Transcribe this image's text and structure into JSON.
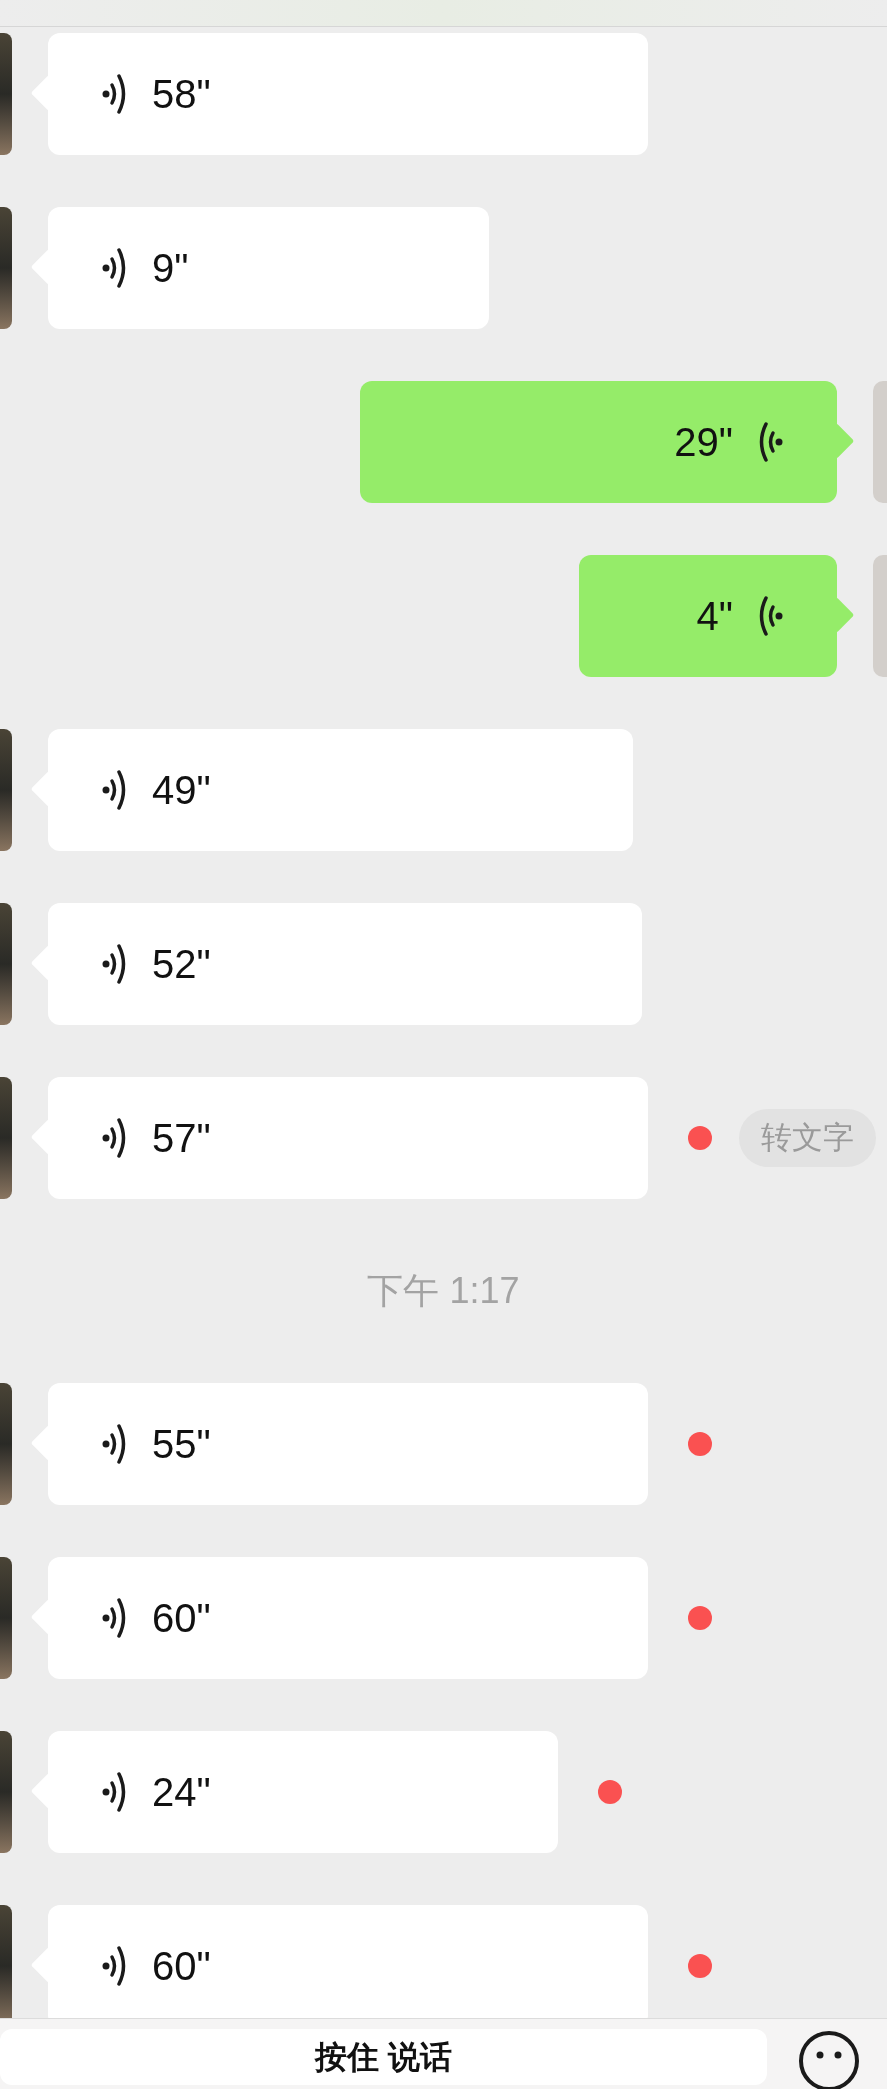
{
  "messages": [
    {
      "kind": "incoming",
      "duration": "58\"",
      "unread": false
    },
    {
      "kind": "incoming",
      "duration": "9\"",
      "unread": false
    },
    {
      "kind": "outgoing",
      "duration": "29\""
    },
    {
      "kind": "outgoing",
      "duration": "4\""
    },
    {
      "kind": "incoming",
      "duration": "49\"",
      "unread": false
    },
    {
      "kind": "incoming",
      "duration": "52\"",
      "unread": false
    },
    {
      "kind": "incoming",
      "duration": "57\"",
      "unread": true,
      "transcribe": "转文字"
    },
    {
      "kind": "time",
      "text": "下午 1:17"
    },
    {
      "kind": "incoming",
      "duration": "55\"",
      "unread": true
    },
    {
      "kind": "incoming",
      "duration": "60\"",
      "unread": true
    },
    {
      "kind": "incoming",
      "duration": "24\"",
      "unread": true
    },
    {
      "kind": "incoming",
      "duration": "60\"",
      "unread": true
    }
  ],
  "input": {
    "label": "按住 说话"
  }
}
